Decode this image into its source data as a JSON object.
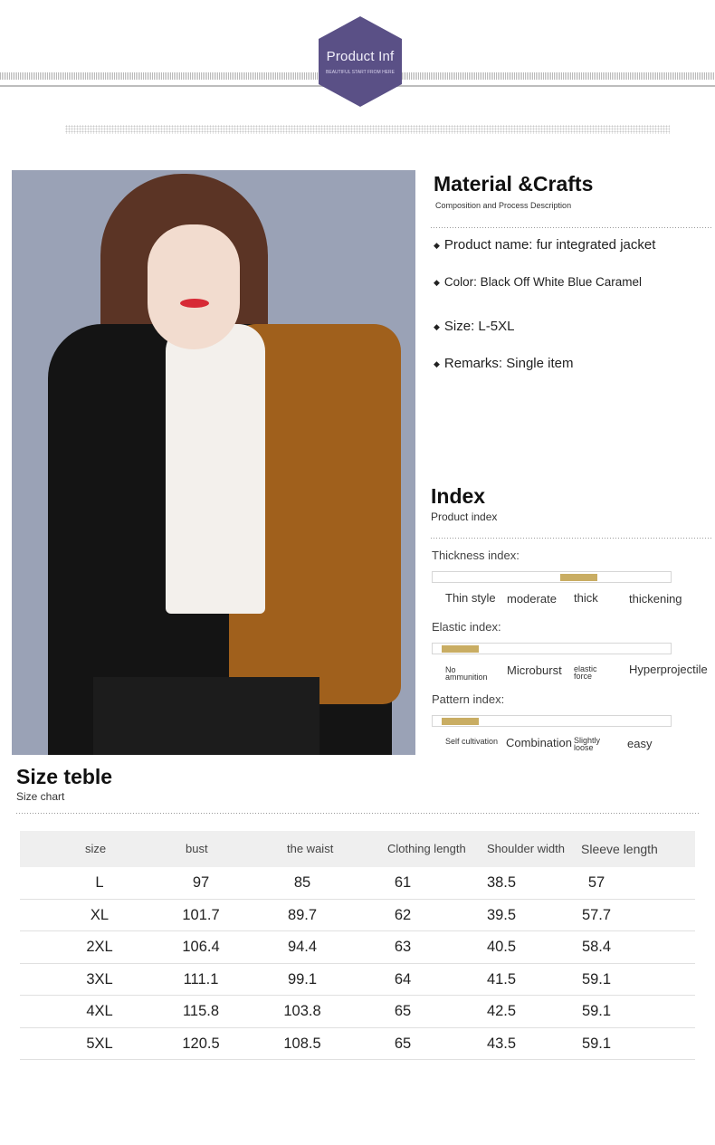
{
  "header": {
    "badge_title": "Product Inf",
    "badge_subtitle": "BEAUTIFUL START FROM HERE"
  },
  "material": {
    "title": "Material &Crafts",
    "subtitle": "Composition and Process Description",
    "bullets": [
      "Product name: fur integrated jacket",
      "Color: Black Off White Blue Caramel",
      "Size: L-5XL",
      "Remarks: Single item"
    ],
    "bullet_symbol": "◆"
  },
  "index": {
    "title": "Index",
    "subtitle": "Product index",
    "thickness": {
      "label": "Thickness index:",
      "options": [
        "Thin style",
        "moderate",
        "thick",
        "thickening"
      ],
      "selected": "thick"
    },
    "elastic": {
      "label": "Elastic index:",
      "options": [
        "No ammunition",
        "Microburst",
        "elastic force",
        "Hyperprojectile"
      ],
      "selected": "No ammunition"
    },
    "pattern": {
      "label": "Pattern index:",
      "options": [
        "Self cultivation",
        "Combination",
        "Slightly loose",
        "easy"
      ],
      "selected": "Self cultivation"
    },
    "accent_color": "#c9ad63"
  },
  "size_table": {
    "title": "Size teble",
    "subtitle": "Size chart",
    "headers": [
      "size",
      "bust",
      "the waist",
      "Clothing length",
      "Shoulder width",
      "Sleeve length"
    ],
    "rows": [
      [
        "L",
        "97",
        "85",
        "61",
        "38.5",
        "57"
      ],
      [
        "XL",
        "101.7",
        "89.7",
        "62",
        "39.5",
        "57.7"
      ],
      [
        "2XL",
        "106.4",
        "94.4",
        "63",
        "40.5",
        "58.4"
      ],
      [
        "3XL",
        "111.1",
        "99.1",
        "64",
        "41.5",
        "59.1"
      ],
      [
        "4XL",
        "115.8",
        "103.8",
        "65",
        "42.5",
        "59.1"
      ],
      [
        "5XL",
        "120.5",
        "108.5",
        "65",
        "43.5",
        "59.1"
      ]
    ]
  }
}
